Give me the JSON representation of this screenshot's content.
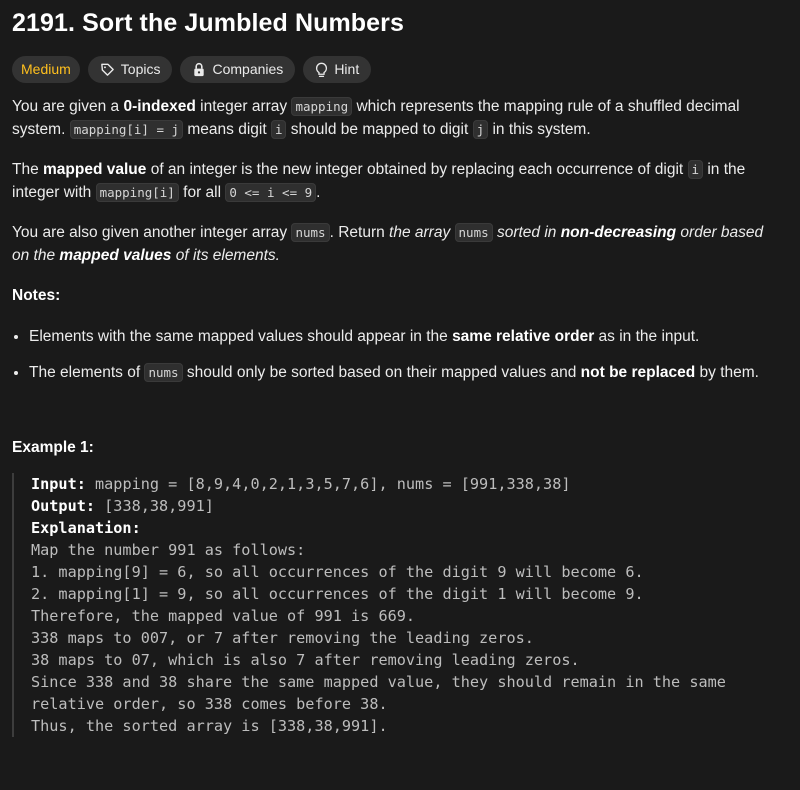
{
  "problem": {
    "title": "2191. Sort the Jumbled Numbers",
    "difficulty": "Medium",
    "colors": {
      "difficulty": "#ffc01e",
      "background": "#1a1a1a",
      "chip_bg": "#333333"
    }
  },
  "chips": {
    "difficulty": "Medium",
    "topics": "Topics",
    "companies": "Companies",
    "hint": "Hint"
  },
  "description": {
    "p1": {
      "t1": "You are given a ",
      "b1": "0-indexed",
      "t2": " integer array ",
      "c1": "mapping",
      "t3": " which represents the mapping rule of a shuffled decimal system. ",
      "c2": "mapping[i] = j",
      "t4": " means digit ",
      "c3": "i",
      "t5": " should be mapped to digit ",
      "c4": "j",
      "t6": " in this system."
    },
    "p2": {
      "t1": "The ",
      "b1": "mapped value",
      "t2": " of an integer is the new integer obtained by replacing each occurrence of digit ",
      "c1": "i",
      "t3": " in the integer with ",
      "c2": "mapping[i]",
      "t4": " for all ",
      "c3": "0 <= i <= 9",
      "t5": "."
    },
    "p3": {
      "t1": "You are also given another integer array ",
      "c1": "nums",
      "t2": ". Return ",
      "e1": "the array ",
      "c2": "nums",
      "e2": " sorted in ",
      "b1": "non-decreasing",
      "e3": " order based on the ",
      "b2": "mapped values",
      "e4": " of its elements."
    },
    "notes_heading": "Notes:",
    "notes": [
      {
        "t1": "Elements with the same mapped values should appear in the ",
        "b1": "same relative order",
        "t2": " as in the input."
      },
      {
        "t1": "The elements of ",
        "c1": "nums",
        "t2": " should only be sorted based on their mapped values and ",
        "b1": "not be replaced",
        "t3": " by them."
      }
    ]
  },
  "example": {
    "heading": "Example 1:",
    "input_label": "Input:",
    "input_value": " mapping = [8,9,4,0,2,1,3,5,7,6], nums = [991,338,38]",
    "output_label": "Output:",
    "output_value": " [338,38,991]",
    "explanation_label": "Explanation:",
    "explanation_lines": [
      "Map the number 991 as follows:",
      "1. mapping[9] = 6, so all occurrences of the digit 9 will become 6.",
      "2. mapping[1] = 9, so all occurrences of the digit 1 will become 9.",
      "Therefore, the mapped value of 991 is 669.",
      "338 maps to 007, or 7 after removing the leading zeros.",
      "38 maps to 07, which is also 7 after removing leading zeros.",
      "Since 338 and 38 share the same mapped value, they should remain in the same",
      "relative order, so 338 comes before 38.",
      "Thus, the sorted array is [338,38,991]."
    ]
  },
  "icons": {
    "topics": "tag-icon",
    "companies": "lock-icon",
    "hint": "lightbulb-icon"
  }
}
